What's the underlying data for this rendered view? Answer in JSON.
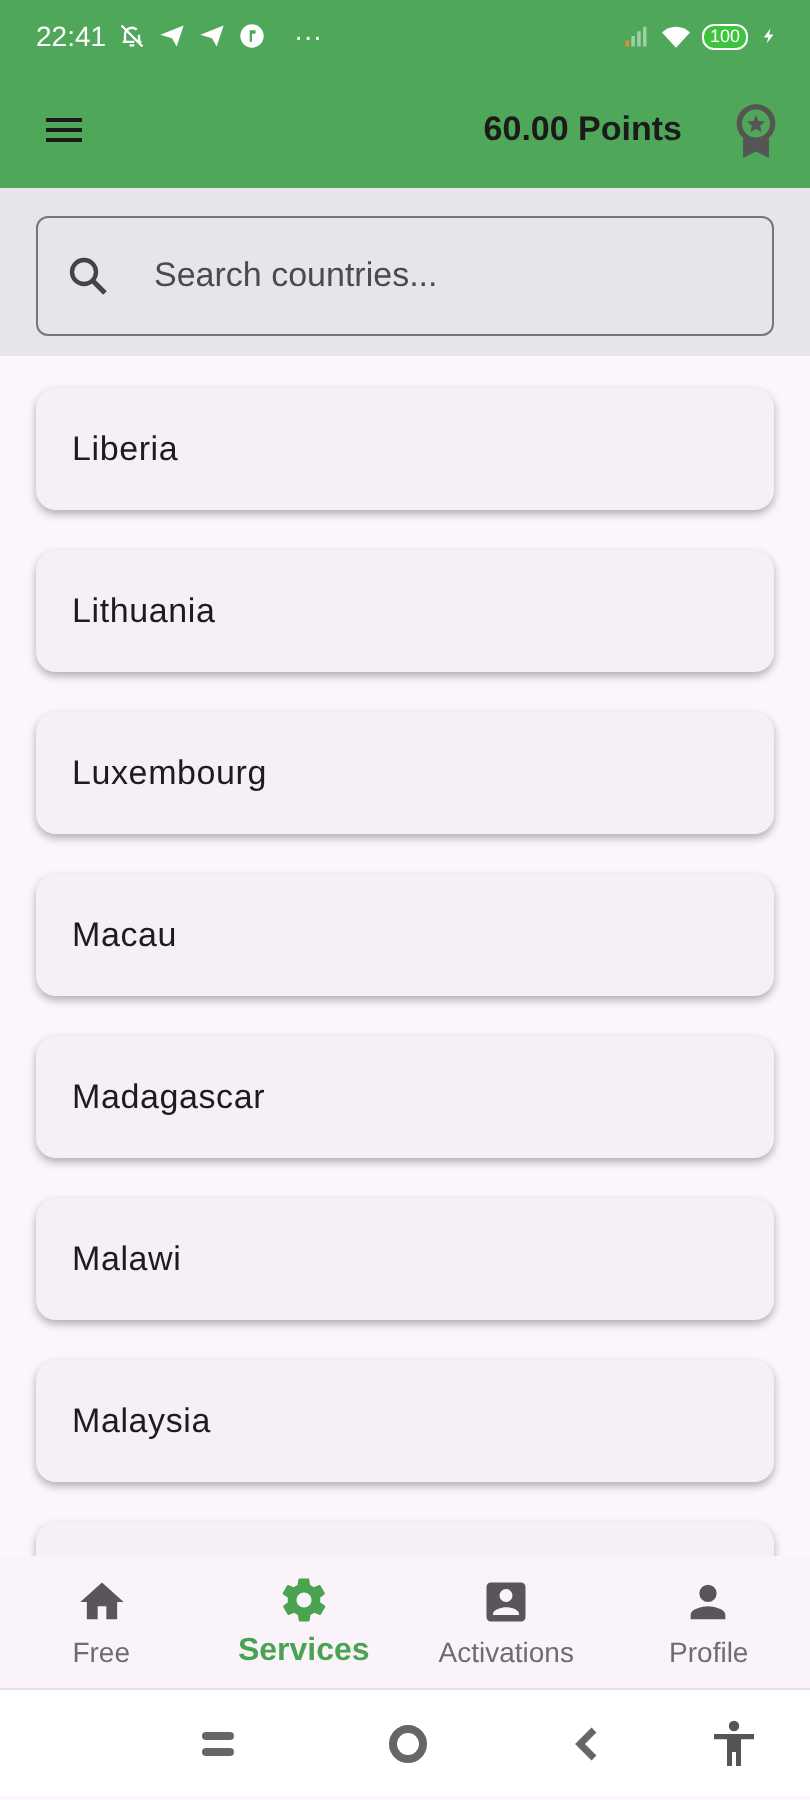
{
  "status_bar": {
    "time": "22:41",
    "more": "···",
    "battery": "100"
  },
  "app_bar": {
    "points": "60.00 Points"
  },
  "search": {
    "placeholder": "Search countries..."
  },
  "countries": [
    {
      "name": "Liberia"
    },
    {
      "name": "Lithuania"
    },
    {
      "name": "Luxembourg"
    },
    {
      "name": "Macau"
    },
    {
      "name": "Madagascar"
    },
    {
      "name": "Malawi"
    },
    {
      "name": "Malaysia"
    }
  ],
  "bottom_nav": [
    {
      "kind": "home",
      "label": "Free",
      "selected": false
    },
    {
      "kind": "gear",
      "label": "Services",
      "selected": true
    },
    {
      "kind": "badge",
      "label": "Activations",
      "selected": false
    },
    {
      "kind": "person",
      "label": "Profile",
      "selected": false
    }
  ]
}
